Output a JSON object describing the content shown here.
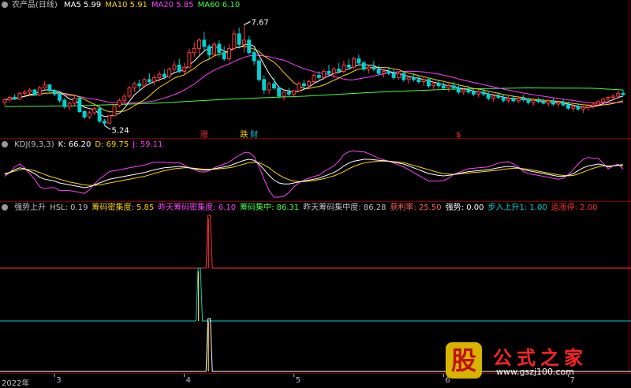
{
  "chart_data": {
    "type": "candlestick",
    "title": "农产品(日线)",
    "ma_legend": [
      {
        "name": "MA5",
        "value": "5.99",
        "color": "#ffffff"
      },
      {
        "name": "MA10",
        "value": "5.91",
        "color": "#ffd400"
      },
      {
        "name": "MA20",
        "value": "5.85",
        "color": "#ff40ff"
      },
      {
        "name": "MA60",
        "value": "6.10",
        "color": "#40ff40"
      }
    ],
    "colors": {
      "up": "#ff3c3c",
      "down": "#00d2d2",
      "grid": "#7a0000"
    },
    "price_range": [
      5.0,
      8.0
    ],
    "annotations": [
      {
        "label": "7.67",
        "index": 48,
        "price": 7.67
      },
      {
        "label": "5.24",
        "index": 20,
        "price": 5.24
      }
    ],
    "signals": [
      {
        "label": "涨",
        "index": 40,
        "color": "#ff3030"
      },
      {
        "label": "跌",
        "index": 48,
        "color": "#ffd400"
      },
      {
        "label": "财",
        "index": 50,
        "color": "#00d2d2"
      },
      {
        "label": "$",
        "index": 91,
        "color": "#ff3030"
      }
    ],
    "candles": [
      [
        5.8,
        5.9,
        5.72,
        5.86
      ],
      [
        5.86,
        5.95,
        5.8,
        5.92
      ],
      [
        5.92,
        6.0,
        5.85,
        5.88
      ],
      [
        5.88,
        6.05,
        5.85,
        6.02
      ],
      [
        6.02,
        6.1,
        5.95,
        6.05
      ],
      [
        6.05,
        6.15,
        5.98,
        6.1
      ],
      [
        6.1,
        6.12,
        5.96,
        5.98
      ],
      [
        5.98,
        6.2,
        5.95,
        6.15
      ],
      [
        6.15,
        6.3,
        6.1,
        6.22
      ],
      [
        6.22,
        6.25,
        6.05,
        6.08
      ],
      [
        6.08,
        6.12,
        5.95,
        6.0
      ],
      [
        6.0,
        6.05,
        5.8,
        5.85
      ],
      [
        5.85,
        5.9,
        5.65,
        5.7
      ],
      [
        5.7,
        5.82,
        5.6,
        5.78
      ],
      [
        5.78,
        5.95,
        5.7,
        5.9
      ],
      [
        5.9,
        5.95,
        5.55,
        5.58
      ],
      [
        5.58,
        5.62,
        5.4,
        5.45
      ],
      [
        5.45,
        5.6,
        5.4,
        5.55
      ],
      [
        5.55,
        5.7,
        5.5,
        5.65
      ],
      [
        5.65,
        5.72,
        5.3,
        5.35
      ],
      [
        5.35,
        5.4,
        5.24,
        5.3
      ],
      [
        5.3,
        5.5,
        5.28,
        5.48
      ],
      [
        5.48,
        5.75,
        5.45,
        5.72
      ],
      [
        5.72,
        5.9,
        5.68,
        5.85
      ],
      [
        5.85,
        6.0,
        5.8,
        5.95
      ],
      [
        5.95,
        6.2,
        5.9,
        6.15
      ],
      [
        6.15,
        6.3,
        6.05,
        6.25
      ],
      [
        6.25,
        6.35,
        6.1,
        6.2
      ],
      [
        6.2,
        6.4,
        6.15,
        6.35
      ],
      [
        6.35,
        6.5,
        6.25,
        6.3
      ],
      [
        6.3,
        6.45,
        6.2,
        6.4
      ],
      [
        6.4,
        6.55,
        6.3,
        6.48
      ],
      [
        6.48,
        6.6,
        6.35,
        6.42
      ],
      [
        6.42,
        6.65,
        6.38,
        6.6
      ],
      [
        6.6,
        6.8,
        6.55,
        6.7
      ],
      [
        6.7,
        6.85,
        6.5,
        6.55
      ],
      [
        6.55,
        6.75,
        6.45,
        6.65
      ],
      [
        6.65,
        7.1,
        6.6,
        7.0
      ],
      [
        7.0,
        7.25,
        6.9,
        7.1
      ],
      [
        7.1,
        7.35,
        6.95,
        7.3
      ],
      [
        7.3,
        7.5,
        7.05,
        7.15
      ],
      [
        7.15,
        7.2,
        6.85,
        6.95
      ],
      [
        6.95,
        7.25,
        6.9,
        7.2
      ],
      [
        7.2,
        7.3,
        6.9,
        7.0
      ],
      [
        7.0,
        7.15,
        6.8,
        6.85
      ],
      [
        6.85,
        7.2,
        6.8,
        7.1
      ],
      [
        7.1,
        7.55,
        7.05,
        7.45
      ],
      [
        7.45,
        7.6,
        7.1,
        7.2
      ],
      [
        7.2,
        7.67,
        7.0,
        7.3
      ],
      [
        7.3,
        7.4,
        6.95,
        7.0
      ],
      [
        7.0,
        7.1,
        6.7,
        6.8
      ],
      [
        6.8,
        6.85,
        6.3,
        6.35
      ],
      [
        6.35,
        6.45,
        6.0,
        6.1
      ],
      [
        6.1,
        6.3,
        6.0,
        6.25
      ],
      [
        6.25,
        6.4,
        6.1,
        6.15
      ],
      [
        6.15,
        6.2,
        5.9,
        5.95
      ],
      [
        5.95,
        6.1,
        5.85,
        6.05
      ],
      [
        6.05,
        6.15,
        5.95,
        6.0
      ],
      [
        6.0,
        6.1,
        5.9,
        6.08
      ],
      [
        6.08,
        6.3,
        6.05,
        6.25
      ],
      [
        6.25,
        6.35,
        6.15,
        6.2
      ],
      [
        6.2,
        6.35,
        6.12,
        6.3
      ],
      [
        6.3,
        6.5,
        6.25,
        6.45
      ],
      [
        6.45,
        6.55,
        6.35,
        6.4
      ],
      [
        6.4,
        6.6,
        6.35,
        6.55
      ],
      [
        6.55,
        6.7,
        6.45,
        6.5
      ],
      [
        6.5,
        6.65,
        6.4,
        6.6
      ],
      [
        6.6,
        6.75,
        6.5,
        6.55
      ],
      [
        6.55,
        6.8,
        6.5,
        6.7
      ],
      [
        6.7,
        6.85,
        6.6,
        6.65
      ],
      [
        6.65,
        6.9,
        6.6,
        6.85
      ],
      [
        6.85,
        6.95,
        6.7,
        6.75
      ],
      [
        6.75,
        6.8,
        6.55,
        6.6
      ],
      [
        6.6,
        6.7,
        6.5,
        6.65
      ],
      [
        6.65,
        6.8,
        6.55,
        6.6
      ],
      [
        6.6,
        6.7,
        6.45,
        6.5
      ],
      [
        6.5,
        6.6,
        6.4,
        6.55
      ],
      [
        6.55,
        6.65,
        6.45,
        6.5
      ],
      [
        6.5,
        6.6,
        6.35,
        6.4
      ],
      [
        6.4,
        6.55,
        6.35,
        6.5
      ],
      [
        6.5,
        6.55,
        6.3,
        6.35
      ],
      [
        6.35,
        6.45,
        6.25,
        6.4
      ],
      [
        6.4,
        6.5,
        6.3,
        6.35
      ],
      [
        6.35,
        6.45,
        6.25,
        6.3
      ],
      [
        6.3,
        6.4,
        6.2,
        6.35
      ],
      [
        6.35,
        6.4,
        6.15,
        6.2
      ],
      [
        6.2,
        6.3,
        6.1,
        6.25
      ],
      [
        6.25,
        6.35,
        6.15,
        6.2
      ],
      [
        6.2,
        6.28,
        6.1,
        6.15
      ],
      [
        6.15,
        6.25,
        6.05,
        6.2
      ],
      [
        6.2,
        6.3,
        6.1,
        6.15
      ],
      [
        6.15,
        6.25,
        6.0,
        6.05
      ],
      [
        6.05,
        6.15,
        5.98,
        6.1
      ],
      [
        6.1,
        6.2,
        6.0,
        6.05
      ],
      [
        6.05,
        6.12,
        5.95,
        6.0
      ],
      [
        6.0,
        6.1,
        5.92,
        6.05
      ],
      [
        6.05,
        6.15,
        5.95,
        6.0
      ],
      [
        6.0,
        6.05,
        5.85,
        5.9
      ],
      [
        5.9,
        6.0,
        5.82,
        5.95
      ],
      [
        5.95,
        6.05,
        5.88,
        5.92
      ],
      [
        5.92,
        6.0,
        5.8,
        5.85
      ],
      [
        5.85,
        5.95,
        5.78,
        5.9
      ],
      [
        5.9,
        5.98,
        5.8,
        5.84
      ],
      [
        5.84,
        5.95,
        5.78,
        5.9
      ],
      [
        5.9,
        5.98,
        5.82,
        5.86
      ],
      [
        5.86,
        5.92,
        5.75,
        5.8
      ],
      [
        5.8,
        5.9,
        5.72,
        5.85
      ],
      [
        5.85,
        5.92,
        5.78,
        5.82
      ],
      [
        5.82,
        5.9,
        5.75,
        5.78
      ],
      [
        5.78,
        5.88,
        5.7,
        5.84
      ],
      [
        5.84,
        5.9,
        5.72,
        5.76
      ],
      [
        5.76,
        5.85,
        5.68,
        5.8
      ],
      [
        5.8,
        5.88,
        5.7,
        5.74
      ],
      [
        5.74,
        5.82,
        5.62,
        5.66
      ],
      [
        5.66,
        5.75,
        5.58,
        5.7
      ],
      [
        5.7,
        5.78,
        5.6,
        5.64
      ],
      [
        5.64,
        5.72,
        5.55,
        5.68
      ],
      [
        5.68,
        5.76,
        5.6,
        5.72
      ],
      [
        5.72,
        5.8,
        5.65,
        5.76
      ],
      [
        5.76,
        5.85,
        5.7,
        5.82
      ],
      [
        5.82,
        5.92,
        5.76,
        5.88
      ],
      [
        5.88,
        5.96,
        5.8,
        5.92
      ],
      [
        5.92,
        6.0,
        5.85,
        5.95
      ],
      [
        5.95,
        6.08,
        5.9,
        6.02
      ],
      [
        6.02,
        6.1,
        5.96,
        5.99
      ]
    ],
    "ma60_anchors": [
      [
        0,
        5.7
      ],
      [
        15,
        5.72
      ],
      [
        30,
        5.78
      ],
      [
        45,
        5.88
      ],
      [
        60,
        5.95
      ],
      [
        75,
        6.05
      ],
      [
        90,
        6.12
      ],
      [
        105,
        6.15
      ],
      [
        118,
        6.14
      ],
      [
        124,
        6.1
      ]
    ],
    "kdj": {
      "legend": [
        {
          "name": "KDJ(9,3,3)",
          "value": "",
          "color": "#c0c0c0"
        },
        {
          "name": "K:",
          "value": "66.20",
          "color": "#ffffff"
        },
        {
          "name": "D:",
          "value": "69.75",
          "color": "#ffd400"
        },
        {
          "name": "J:",
          "value": "59.11",
          "color": "#ff40ff"
        }
      ],
      "range": [
        0,
        100
      ],
      "k": [
        48,
        52,
        58,
        62,
        60,
        55,
        50,
        42,
        38,
        36,
        34,
        30,
        28,
        26,
        24,
        22,
        20,
        22,
        26,
        30,
        34,
        38,
        40,
        42,
        44,
        46,
        48,
        50,
        52,
        55,
        58,
        60,
        62,
        63,
        64,
        65,
        64,
        62,
        60,
        58,
        57,
        58,
        60,
        62,
        64,
        66,
        70,
        74,
        78,
        80,
        78,
        70,
        58,
        46,
        36,
        30,
        28,
        28,
        30,
        32,
        34,
        36,
        38,
        40,
        44,
        48,
        52,
        58,
        66,
        72,
        76,
        78,
        80,
        80,
        79,
        78,
        77,
        76,
        74,
        72,
        70,
        66,
        62,
        58,
        54,
        50,
        48,
        46,
        45,
        46,
        48,
        50,
        52,
        54,
        55,
        56,
        57,
        58,
        60,
        62,
        64,
        65,
        64,
        62,
        58,
        56,
        54,
        52,
        50,
        48,
        46,
        44,
        44,
        46,
        50,
        56,
        62,
        66,
        68,
        70,
        68,
        64,
        66,
        68,
        66
      ],
      "d": [
        50,
        52,
        55,
        58,
        59,
        58,
        56,
        52,
        48,
        44,
        41,
        38,
        35,
        32,
        30,
        28,
        26,
        25,
        25,
        26,
        28,
        30,
        32,
        34,
        36,
        38,
        40,
        42,
        44,
        47,
        50,
        53,
        56,
        58,
        60,
        61,
        62,
        62,
        61,
        60,
        59,
        59,
        59,
        60,
        61,
        62,
        64,
        67,
        70,
        73,
        74,
        73,
        68,
        62,
        54,
        47,
        41,
        37,
        34,
        33,
        33,
        34,
        35,
        37,
        39,
        42,
        45,
        49,
        54,
        60,
        65,
        69,
        72,
        74,
        75,
        76,
        76,
        76,
        75,
        74,
        73,
        70,
        67,
        64,
        61,
        58,
        55,
        52,
        50,
        49,
        48,
        49,
        50,
        51,
        52,
        53,
        54,
        55,
        56,
        57,
        59,
        60,
        61,
        61,
        60,
        59,
        57,
        55,
        53,
        51,
        49,
        47,
        46,
        45,
        46,
        49,
        53,
        57,
        61,
        64,
        66,
        66,
        66,
        67,
        69.75
      ],
      "j": [
        44,
        52,
        64,
        70,
        62,
        49,
        38,
        22,
        18,
        20,
        20,
        14,
        14,
        14,
        12,
        10,
        8,
        16,
        28,
        38,
        46,
        54,
        56,
        58,
        60,
        62,
        64,
        66,
        68,
        71,
        74,
        74,
        74,
        73,
        72,
        73,
        68,
        62,
        58,
        54,
        53,
        56,
        62,
        66,
        70,
        74,
        82,
        88,
        94,
        94,
        86,
        64,
        38,
        14,
        0,
        0,
        2,
        10,
        22,
        30,
        36,
        40,
        44,
        46,
        54,
        60,
        66,
        76,
        90,
        96,
        98,
        96,
        96,
        92,
        87,
        82,
        79,
        76,
        72,
        68,
        64,
        58,
        52,
        46,
        40,
        34,
        34,
        34,
        35,
        40,
        48,
        52,
        56,
        60,
        61,
        62,
        63,
        64,
        68,
        72,
        74,
        75,
        70,
        64,
        54,
        50,
        48,
        46,
        44,
        42,
        40,
        38,
        40,
        48,
        58,
        70,
        80,
        84,
        82,
        82,
        72,
        60,
        66,
        70,
        59.11
      ]
    },
    "ind": {
      "legend": [
        {
          "name": "强势上升",
          "value": "",
          "color": "#c0c0c0"
        },
        {
          "name": "HSL:",
          "value": "0.19",
          "color": "#c0c0c0"
        },
        {
          "name": "筹码密集度:",
          "value": "5.85",
          "color": "#ffd400"
        },
        {
          "name": "昨天筹码密集度:",
          "value": "6.10",
          "color": "#ff40ff"
        },
        {
          "name": "筹码集中:",
          "value": "86.31",
          "color": "#40ff40"
        },
        {
          "name": "昨天筹码集中度:",
          "value": "86.28",
          "color": "#c0c0c0"
        },
        {
          "name": "获利率:",
          "value": "25.50",
          "color": "#ff6060"
        },
        {
          "name": "强势:",
          "value": "0.00",
          "color": "#ffffff"
        },
        {
          "name": "步入上升1:",
          "value": "1.00",
          "color": "#00d2d2"
        },
        {
          "name": "追涨停:",
          "value": "2.00",
          "color": "#ff3030"
        }
      ],
      "lines": [
        {
          "name": "追涨停",
          "baseline": 2,
          "spike_index": 41,
          "color": "#ff3030"
        },
        {
          "name": "步入上升1",
          "baseline": 1,
          "spike_index": 39,
          "color": "#00d2d2"
        },
        {
          "name": "强势",
          "baseline": 0,
          "spike_index": 41,
          "color": "#ffffff"
        }
      ]
    },
    "x_ticks": [
      {
        "label": "2022年",
        "index": 0
      },
      {
        "label": "3",
        "index": 10
      },
      {
        "label": "4",
        "index": 36
      },
      {
        "label": "5",
        "index": 58
      },
      {
        "label": "6",
        "index": 88
      },
      {
        "label": "7",
        "index": 113
      }
    ]
  },
  "watermark": {
    "mark": "股",
    "title": "公式之家",
    "url": "www.gszj100.com"
  }
}
